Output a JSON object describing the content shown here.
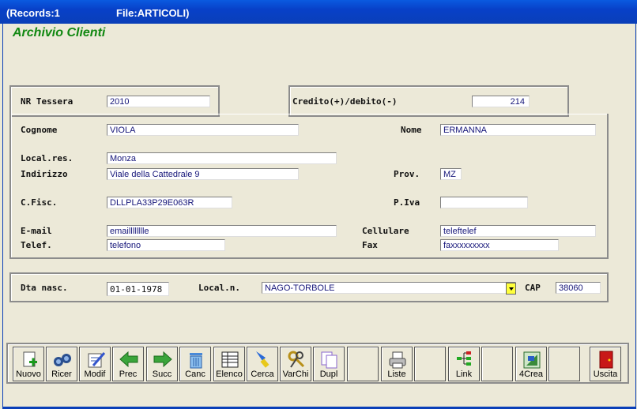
{
  "window": {
    "records": "(Records:1",
    "file": "File:ARTICOLI)"
  },
  "heading": "Archivio Clienti",
  "tessera": {
    "label": "NR Tessera",
    "value": "2010"
  },
  "credito": {
    "label": "Credito(+)/debito(-)",
    "value": "214"
  },
  "cognome": {
    "label": "Cognome",
    "value": "VIOLA"
  },
  "nome": {
    "label": "Nome",
    "value": "ERMANNA"
  },
  "localres": {
    "label": "Local.res.",
    "value": "Monza"
  },
  "indirizzo": {
    "label": "Indirizzo",
    "value": "Viale della Cattedrale 9"
  },
  "prov": {
    "label": "Prov.",
    "value": "MZ"
  },
  "cfisc": {
    "label": "C.Fisc.",
    "value": "DLLPLA33P29E063R"
  },
  "piva": {
    "label": "P.Iva",
    "value": ""
  },
  "email": {
    "label": "E-mail",
    "value": "emailllllllle"
  },
  "cellulare": {
    "label": "Cellulare",
    "value": "teleftelef"
  },
  "telef": {
    "label": "Telef.",
    "value": "telefono"
  },
  "fax": {
    "label": "Fax",
    "value": "faxxxxxxxxx"
  },
  "dtanasc": {
    "label": "Dta nasc.",
    "value": "01-01-1978"
  },
  "localn": {
    "label": "Local.n.",
    "value": "NAGO-TORBOLE"
  },
  "cap": {
    "label": "CAP",
    "value": "38060"
  },
  "toolbar": {
    "nuovo": "Nuovo",
    "ricer": "Ricer",
    "modif": "Modif",
    "prec": "Prec",
    "succ": "Succ",
    "canc": "Canc",
    "elenco": "Elenco",
    "cerca": "Cerca",
    "varchi": "VarChi",
    "dupl": "Dupl",
    "liste": "Liste",
    "link": "Link",
    "crea": "4Crea",
    "uscita": "Uscita"
  }
}
